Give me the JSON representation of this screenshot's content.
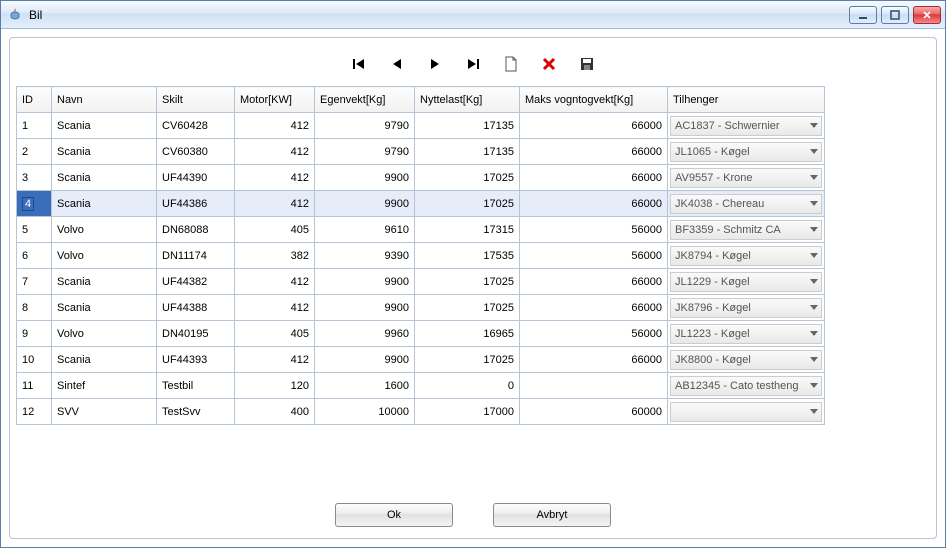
{
  "window": {
    "title": "Bil"
  },
  "toolbar": {
    "first": "first",
    "prev": "prev",
    "next": "next",
    "last": "last",
    "new": "new",
    "delete": "delete",
    "save": "save"
  },
  "table": {
    "headers": {
      "id": "ID",
      "navn": "Navn",
      "skilt": "Skilt",
      "motor": "Motor[KW]",
      "egen": "Egenvekt[Kg]",
      "nytt": "Nyttelast[Kg]",
      "maks": "Maks vogntogvekt[Kg]",
      "tilhenger": "Tilhenger"
    },
    "rows": [
      {
        "id": "1",
        "navn": "Scania",
        "skilt": "CV60428",
        "motor": "412",
        "egen": "9790",
        "nytt": "17135",
        "maks": "66000",
        "tilhenger": "AC1837 - Schwernier",
        "selected": false
      },
      {
        "id": "2",
        "navn": "Scania",
        "skilt": "CV60380",
        "motor": "412",
        "egen": "9790",
        "nytt": "17135",
        "maks": "66000",
        "tilhenger": "JL1065 - Køgel",
        "selected": false
      },
      {
        "id": "3",
        "navn": "Scania",
        "skilt": "UF44390",
        "motor": "412",
        "egen": "9900",
        "nytt": "17025",
        "maks": "66000",
        "tilhenger": "AV9557 - Krone",
        "selected": false
      },
      {
        "id": "4",
        "navn": "Scania",
        "skilt": "UF44386",
        "motor": "412",
        "egen": "9900",
        "nytt": "17025",
        "maks": "66000",
        "tilhenger": "JK4038 - Chereau",
        "selected": true
      },
      {
        "id": "5",
        "navn": "Volvo",
        "skilt": "DN68088",
        "motor": "405",
        "egen": "9610",
        "nytt": "17315",
        "maks": "56000",
        "tilhenger": "BF3359 - Schmitz CA",
        "selected": false
      },
      {
        "id": "6",
        "navn": "Volvo",
        "skilt": "DN11174",
        "motor": "382",
        "egen": "9390",
        "nytt": "17535",
        "maks": "56000",
        "tilhenger": "JK8794 - Køgel",
        "selected": false
      },
      {
        "id": "7",
        "navn": "Scania",
        "skilt": "UF44382",
        "motor": "412",
        "egen": "9900",
        "nytt": "17025",
        "maks": "66000",
        "tilhenger": "JL1229 - Køgel",
        "selected": false
      },
      {
        "id": "8",
        "navn": "Scania",
        "skilt": "UF44388",
        "motor": "412",
        "egen": "9900",
        "nytt": "17025",
        "maks": "66000",
        "tilhenger": "JK8796 - Køgel",
        "selected": false
      },
      {
        "id": "9",
        "navn": "Volvo",
        "skilt": "DN40195",
        "motor": "405",
        "egen": "9960",
        "nytt": "16965",
        "maks": "56000",
        "tilhenger": "JL1223 - Køgel",
        "selected": false
      },
      {
        "id": "10",
        "navn": "Scania",
        "skilt": "UF44393",
        "motor": "412",
        "egen": "9900",
        "nytt": "17025",
        "maks": "66000",
        "tilhenger": "JK8800 - Køgel",
        "selected": false
      },
      {
        "id": "11",
        "navn": "Sintef",
        "skilt": "Testbil",
        "motor": "120",
        "egen": "1600",
        "nytt": "0",
        "maks": "",
        "tilhenger": "AB12345 - Cato testheng",
        "selected": false
      },
      {
        "id": "12",
        "navn": "SVV",
        "skilt": "TestSvv",
        "motor": "400",
        "egen": "10000",
        "nytt": "17000",
        "maks": "60000",
        "tilhenger": "",
        "selected": false
      }
    ]
  },
  "buttons": {
    "ok": "Ok",
    "cancel": "Avbryt"
  }
}
